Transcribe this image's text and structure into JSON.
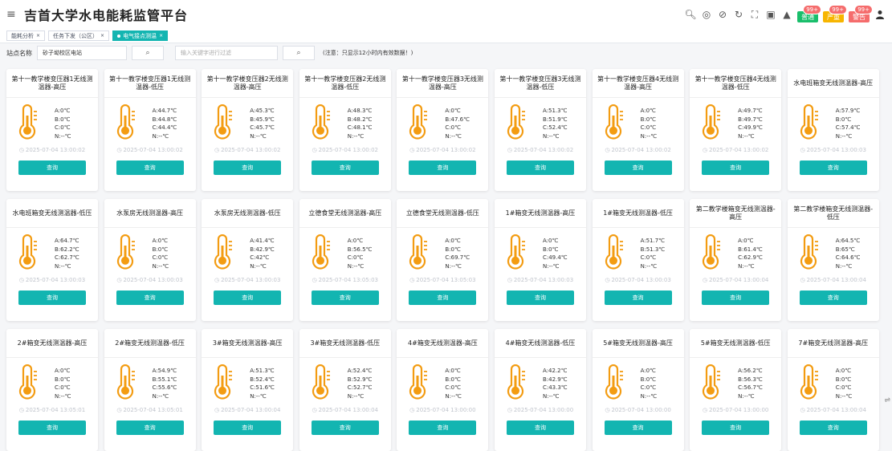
{
  "app": {
    "title": "吉首大学水电能耗监管平台"
  },
  "header": {
    "badges": [
      {
        "label": "普通",
        "count": "99+",
        "color": "#19be6b"
      },
      {
        "label": "严重",
        "count": "99+",
        "color": "#f7b500"
      },
      {
        "label": "警告",
        "count": "99+",
        "color": "#f56c6c"
      }
    ]
  },
  "tabs": [
    {
      "label": "能耗分析",
      "active": false
    },
    {
      "label": "任务下发（公区）",
      "active": false
    },
    {
      "label": "电气接点测温",
      "active": true
    }
  ],
  "search": {
    "station_label": "站点名称",
    "station_value": "砂子坳校区电站",
    "keyword_placeholder": "输入关键字进行过滤",
    "note": "(注意：只显示12小时内有效数据！)"
  },
  "query_label": "查询",
  "cards": [
    {
      "title": "第十一教学楼变压器1无线测温器-高压",
      "a": "A:0℃",
      "b": "B:0℃",
      "c": "C:0℃",
      "n": "N:--℃",
      "time": "2025-07-04 13:00:02"
    },
    {
      "title": "第十一教学楼变压器1无线测温器-低压",
      "a": "A:44.7℃",
      "b": "B:44.8℃",
      "c": "C:44.4℃",
      "n": "N:--℃",
      "time": "2025-07-04 13:00:02"
    },
    {
      "title": "第十一教学楼变压器2无线测温器-高压",
      "a": "A:45.3℃",
      "b": "B:45.9℃",
      "c": "C:45.7℃",
      "n": "N:--℃",
      "time": "2025-07-04 13:00:02"
    },
    {
      "title": "第十一教学楼变压器2无线测温器-低压",
      "a": "A:48.3℃",
      "b": "B:48.2℃",
      "c": "C:48.1℃",
      "n": "N:--℃",
      "time": "2025-07-04 13:00:02"
    },
    {
      "title": "第十一教学楼变压器3无线测温器-高压",
      "a": "A:0℃",
      "b": "B:47.6℃",
      "c": "C:0℃",
      "n": "N:--℃",
      "time": "2025-07-04 13:00:02"
    },
    {
      "title": "第十一教学楼变压器3无线测温器-低压",
      "a": "A:51.3℃",
      "b": "B:51.9℃",
      "c": "C:52.4℃",
      "n": "N:--℃",
      "time": "2025-07-04 13:00:02"
    },
    {
      "title": "第十一教学楼变压器4无线测温器-高压",
      "a": "A:0℃",
      "b": "B:0℃",
      "c": "C:0℃",
      "n": "N:--℃",
      "time": "2025-07-04 13:00:02"
    },
    {
      "title": "第十一教学楼变压器4无线测温器-低压",
      "a": "A:49.7℃",
      "b": "B:49.7℃",
      "c": "C:49.9℃",
      "n": "N:--℃",
      "time": "2025-07-04 13:00:02"
    },
    {
      "title": "水电班箱变无线测温器-高压",
      "a": "A:57.9℃",
      "b": "B:0℃",
      "c": "C:57.4℃",
      "n": "N:--℃",
      "time": "2025-07-04 13:00:03"
    },
    {
      "title": "水电班箱变无线测温器-低压",
      "a": "A:64.7℃",
      "b": "B:62.2℃",
      "c": "C:62.7℃",
      "n": "N:--℃",
      "time": "2025-07-04 13:00:03"
    },
    {
      "title": "水泵房无线测温器-高压",
      "a": "A:0℃",
      "b": "B:0℃",
      "c": "C:0℃",
      "n": "N:--℃",
      "time": "2025-07-04 13:00:03"
    },
    {
      "title": "水泵房无线测温器-低压",
      "a": "A:41.4℃",
      "b": "B:42.9℃",
      "c": "C:42℃",
      "n": "N:--℃",
      "time": "2025-07-04 13:00:03"
    },
    {
      "title": "立德食堂无线测温器-高压",
      "a": "A:0℃",
      "b": "B:56.5℃",
      "c": "C:0℃",
      "n": "N:--℃",
      "time": "2025-07-04 13:05:03"
    },
    {
      "title": "立德食堂无线测温器-低压",
      "a": "A:0℃",
      "b": "B:0℃",
      "c": "C:69.7℃",
      "n": "N:--℃",
      "time": "2025-07-04 13:05:03"
    },
    {
      "title": "1#箱变无线测温器-高压",
      "a": "A:0℃",
      "b": "B:0℃",
      "c": "C:49.4℃",
      "n": "N:--℃",
      "time": "2025-07-04 13:00:03"
    },
    {
      "title": "1#箱变无线测温器-低压",
      "a": "A:51.7℃",
      "b": "B:51.3℃",
      "c": "C:0℃",
      "n": "N:--℃",
      "time": "2025-07-04 13:00:03"
    },
    {
      "title": "第二教学楼箱变无线测温器-高压",
      "a": "A:0℃",
      "b": "B:61.4℃",
      "c": "C:62.9℃",
      "n": "N:--℃",
      "time": "2025-07-04 13:00:04"
    },
    {
      "title": "第二教学楼箱变无线测温器-低压",
      "a": "A:64.5℃",
      "b": "B:65℃",
      "c": "C:64.6℃",
      "n": "N:--℃",
      "time": "2025-07-04 13:00:04"
    },
    {
      "title": "2#箱变无线测温器-高压",
      "a": "A:0℃",
      "b": "B:0℃",
      "c": "C:0℃",
      "n": "N:--℃",
      "time": "2025-07-04 13:05:01"
    },
    {
      "title": "2#箱变无线测温器-低压",
      "a": "A:54.9℃",
      "b": "B:55.1℃",
      "c": "C:55.6℃",
      "n": "N:--℃",
      "time": "2025-07-04 13:05:01"
    },
    {
      "title": "3#箱变无线测温器-高压",
      "a": "A:51.3℃",
      "b": "B:52.4℃",
      "c": "C:51.6℃",
      "n": "N:--℃",
      "time": "2025-07-04 13:00:04"
    },
    {
      "title": "3#箱变无线测温器-低压",
      "a": "A:52.4℃",
      "b": "B:52.9℃",
      "c": "C:52.7℃",
      "n": "N:--℃",
      "time": "2025-07-04 13:00:04"
    },
    {
      "title": "4#箱变无线测温器-高压",
      "a": "A:0℃",
      "b": "B:0℃",
      "c": "C:0℃",
      "n": "N:--℃",
      "time": "2025-07-04 13:00:00"
    },
    {
      "title": "4#箱变无线测温器-低压",
      "a": "A:42.2℃",
      "b": "B:42.9℃",
      "c": "C:43.3℃",
      "n": "N:--℃",
      "time": "2025-07-04 13:00:00"
    },
    {
      "title": "5#箱变无线测温器-高压",
      "a": "A:0℃",
      "b": "B:0℃",
      "c": "C:0℃",
      "n": "N:--℃",
      "time": "2025-07-04 13:00:00"
    },
    {
      "title": "5#箱变无线测温器-低压",
      "a": "A:56.2℃",
      "b": "B:56.3℃",
      "c": "C:56.7℃",
      "n": "N:--℃",
      "time": "2025-07-04 13:00:00"
    },
    {
      "title": "7#箱变无线测温器-高压",
      "a": "A:0℃",
      "b": "B:0℃",
      "c": "C:0℃",
      "n": "N:--℃",
      "time": "2025-07-04 13:00:04"
    }
  ]
}
